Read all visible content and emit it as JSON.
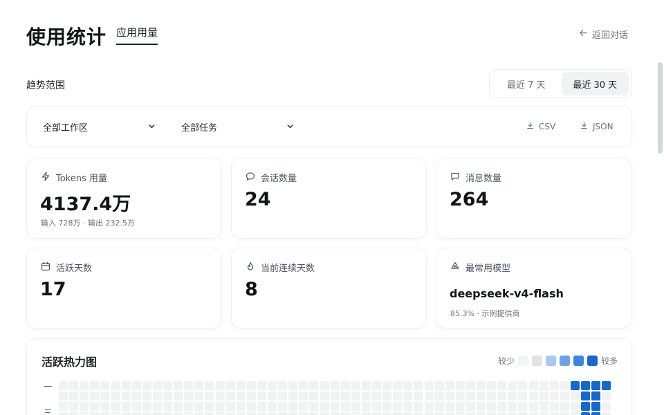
{
  "header": {
    "title": "使用统计",
    "tab": "应用用量",
    "back": "返回对话"
  },
  "range": {
    "label": "趋势范围",
    "options": [
      "最近 7 天",
      "最近 30 天"
    ],
    "selected": "最近 30 天"
  },
  "filters": {
    "workspace": "全部工作区",
    "task": "全部任务",
    "export_csv": "CSV",
    "export_json": "JSON"
  },
  "stats": {
    "tokens": {
      "icon": "lightning-icon",
      "label": "Tokens 用量",
      "value": "4137.4万",
      "sub": "输入 728万 · 输出 232.5万"
    },
    "sessions": {
      "icon": "chat-bubble-icon",
      "label": "会话数量",
      "value": "24"
    },
    "messages": {
      "icon": "message-square-icon",
      "label": "消息数量",
      "value": "264"
    },
    "active_days": {
      "icon": "calendar-icon",
      "label": "活跃天数",
      "value": "17"
    },
    "streak": {
      "icon": "flame-icon",
      "label": "当前连续天数",
      "value": "8"
    },
    "top_model": {
      "icon": "model-icon",
      "label": "最常用模型",
      "value": "deepseek-v4-flash",
      "sub": "85.3% · 示例提供商"
    }
  },
  "heatmap": {
    "title": "活跃热力图",
    "legend_less": "较少",
    "legend_more": "较多",
    "legend_colors": [
      "#f3f4f6",
      "#e1e3e7",
      "#a9c8ef",
      "#6ea2e3",
      "#3f85dc",
      "#1967c9"
    ],
    "row_labels": [
      "一",
      "三"
    ]
  }
}
